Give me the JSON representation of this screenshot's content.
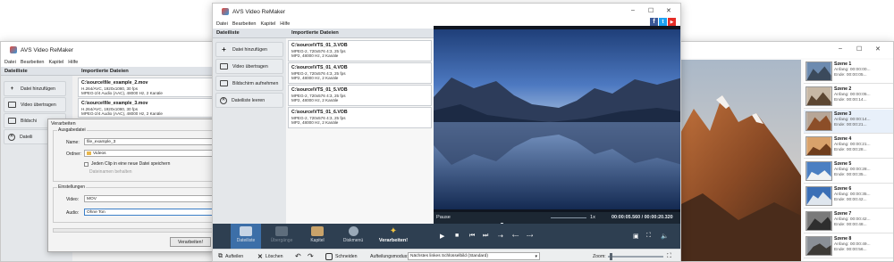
{
  "back_left": {
    "title": "AVS Video ReMaker",
    "menu": [
      "Datei",
      "Bearbeiten",
      "Kapitel",
      "Hilfe"
    ],
    "col_file_list": "Dateiliste",
    "col_imported": "Importierte Dateien",
    "buttons": [
      "Datei hinzufügen",
      "Video übertragen",
      "Bildschi",
      "Dateili"
    ],
    "files": [
      {
        "path": "C:\\source\\file_example_2.mov",
        "l1": "H.264/AVC, 1920x1080, 30 fps",
        "l2": "MPEG-2/4 Audio (AAC), 48000 Hz, 2 Kanäle"
      },
      {
        "path": "C:\\source\\file_example_3.mov",
        "l1": "H.264/AVC, 1920x1080, 30 fps",
        "l2": "MPEG-2/4 Audio (AAC), 48000 Hz, 2 Kanäle"
      }
    ],
    "dialog": {
      "title": "Verarbeiten",
      "group_output": "Ausgabedatei",
      "name_label": "Name:",
      "name_value": "file_example_3",
      "folder_label": "Ordner:",
      "folder_value": "Videos",
      "check1": "Jeden Clip in eine neue Datei speichern",
      "check2": "Dateinamen behalten",
      "group_settings": "Einstellungen",
      "video_label": "Video:",
      "video_value": "MOV",
      "audio_label": "Audio:",
      "audio_value": "Ohne Ton",
      "button": "Verarbeiten!"
    }
  },
  "front": {
    "title": "AVS Video ReMaker",
    "menu": [
      "Datei",
      "Bearbeiten",
      "Kapitel",
      "Hilfe"
    ],
    "col_file_list": "Dateiliste",
    "col_imported": "Importierte Dateien",
    "buttons": [
      "Datei hinzufügen",
      "Video übertragen",
      "Bildschirm aufnehmen",
      "Dateiliste leeren"
    ],
    "files": [
      {
        "path": "C:\\source\\VTS_01_3.VOB",
        "l1": "MPEG-2, 720x576 4:3, 25 fps",
        "l2": "MP2, 48000 Hz, 2 Kanäle"
      },
      {
        "path": "C:\\source\\VTS_01_4.VOB",
        "l1": "MPEG-2, 720x576 4:3, 25 fps",
        "l2": "MP2, 48000 Hz, 2 Kanäle"
      },
      {
        "path": "C:\\source\\VTS_01_5.VOB",
        "l1": "MPEG-2, 720x576 4:3, 25 fps",
        "l2": "MP2, 48000 Hz, 2 Kanäle"
      },
      {
        "path": "C:\\source\\VTS_01_6.VOB",
        "l1": "MPEG-2, 720x576 4:3, 25 fps",
        "l2": "MP2, 48000 Hz, 2 Kanäle"
      }
    ],
    "player": {
      "status": "Pause",
      "speed": "1x",
      "time": "00:00:05.560 / 00:00:20.320"
    },
    "tools": [
      "Dateiliste",
      "Übergänge",
      "Kapitel",
      "Diskmenü",
      "Verarbeiten!"
    ]
  },
  "bottom_bar": {
    "aufteilen": "Aufteilen",
    "loeschen": "Löschen",
    "schneiden": "Schneiden",
    "mode_label": "Aufteilungsmodus:",
    "mode_value": "Nächstes linkes Schlüsselbild (Standard)",
    "zoom_label": "Zoom:"
  },
  "scenes": [
    {
      "name": "Szene 1",
      "start": "Anfang: 00:00:00...",
      "end": "Ende:   00:00:05..."
    },
    {
      "name": "Szene 2",
      "start": "Anfang: 00:00:05...",
      "end": "Ende:   00:00:14..."
    },
    {
      "name": "Szene 3",
      "start": "Anfang: 00:00:14...",
      "end": "Ende:   00:00:21..."
    },
    {
      "name": "Szene 4",
      "start": "Anfang: 00:00:21...",
      "end": "Ende:   00:00:28..."
    },
    {
      "name": "Szene 5",
      "start": "Anfang: 00:00:28...",
      "end": "Ende:   00:00:35..."
    },
    {
      "name": "Szene 6",
      "start": "Anfang: 00:00:35...",
      "end": "Ende:   00:00:42..."
    },
    {
      "name": "Szene 7",
      "start": "Anfang: 00:00:42...",
      "end": "Ende:   00:00:48..."
    },
    {
      "name": "Szene 8",
      "start": "Anfang: 00:00:49...",
      "end": "Ende:   00:00:56..."
    }
  ],
  "right_window_controls": [
    "–",
    "☐",
    "✕"
  ]
}
